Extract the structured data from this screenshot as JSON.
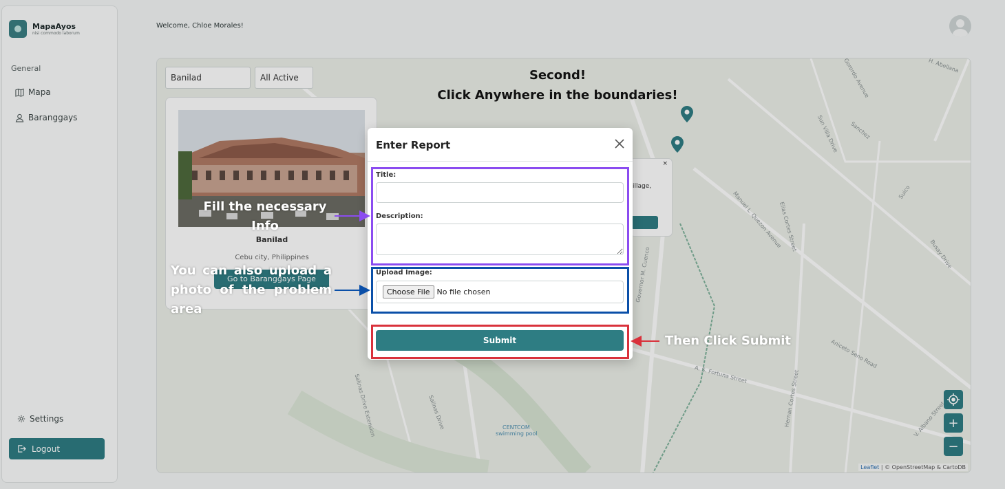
{
  "app": {
    "name": "MapaAyos",
    "tagline": "nisi commodo laborum"
  },
  "sidebar": {
    "group_label": "General",
    "items": [
      {
        "label": "Mapa"
      },
      {
        "label": "Baranggays"
      }
    ],
    "settings_label": "Settings",
    "logout_label": "Logout"
  },
  "header": {
    "welcome": "Welcome, Chloe Morales!"
  },
  "filters": {
    "barangay": "Banilad",
    "status": "All Active"
  },
  "card": {
    "title": "Banilad",
    "subtitle": "Cebu city, Philippines",
    "button_label": "Go to Baranggays Page"
  },
  "popup": {
    "text": "illage,",
    "close": "×"
  },
  "map": {
    "attribution_link": "Leaflet",
    "attribution_text": " | © OpenStreetMap & CartoDB",
    "zoom_in": "+",
    "zoom_out": "−",
    "streets": [
      "Gorordo Avenue",
      "Sanchez",
      "Sun Villa Drive",
      "Busay Drive",
      "Suico",
      "Manuel L. Quezon Avenue",
      "Elias Cortes Street",
      "Governor M. Cuenco",
      "A. S. Fortuna Street",
      "Hernan Cortes Street",
      "Aniceto Seno Road",
      "V. Albano Street",
      "Salinas Drive Extension",
      "Salinas Drive",
      "CENTCOM",
      "swimming pool",
      "H. Abellana"
    ]
  },
  "modal": {
    "title": "Enter Report",
    "title_label": "Title:",
    "title_value": "",
    "description_label": "Description:",
    "description_value": "",
    "upload_label": "Upload Image:",
    "choose_file": "Choose File",
    "no_file": "No file chosen",
    "submit_label": "Submit"
  },
  "annotations": {
    "step2_line1": "Second!",
    "step2_line2": "Click Anywhere in the boundaries!",
    "fill": "Fill the necessary Info",
    "upload": "You can also upload a photo of the problem area",
    "submit": "Then Click Submit",
    "colors": {
      "fill": "#8b4cf0",
      "upload": "#0a4fa8",
      "submit": "#d9313b"
    }
  },
  "colors": {
    "accent": "#2e7d83"
  }
}
